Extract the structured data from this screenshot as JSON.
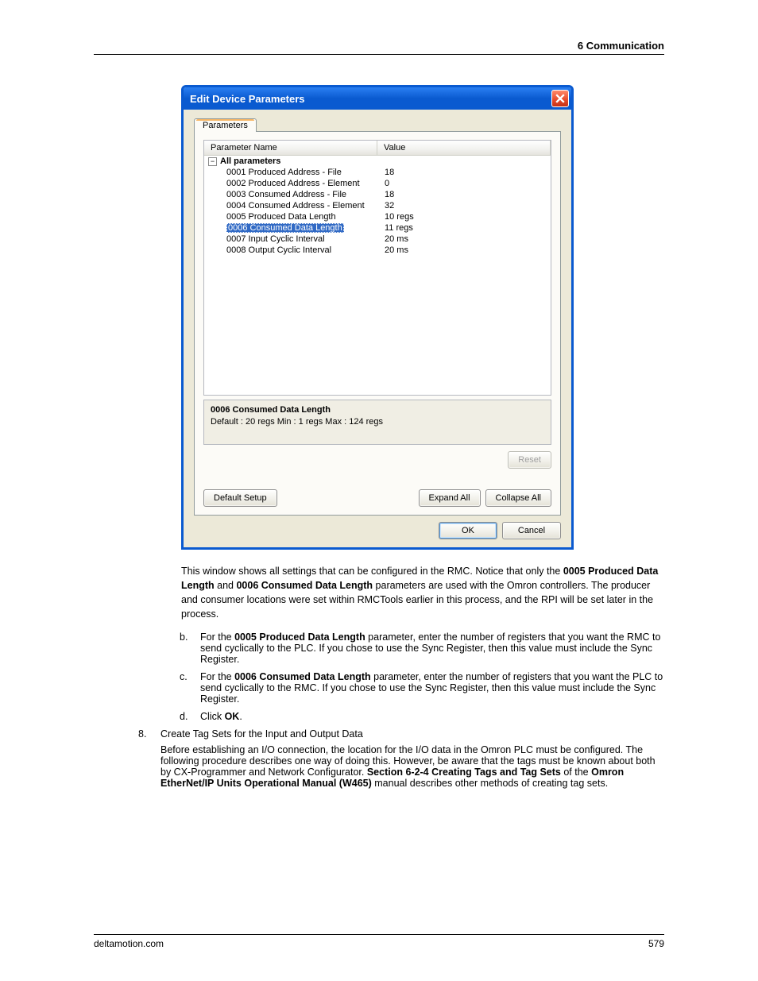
{
  "header": {
    "title": "6  Communication"
  },
  "footer": {
    "site": "deltamotion.com",
    "page": "579"
  },
  "dialog": {
    "title": "Edit Device Parameters",
    "tab_label": "Parameters",
    "columns": {
      "name": "Parameter Name",
      "value": "Value"
    },
    "group_label": "All parameters",
    "rows": [
      {
        "name": "0001 Produced Address - File",
        "value": "18"
      },
      {
        "name": "0002 Produced Address - Element",
        "value": "0"
      },
      {
        "name": "0003 Consumed Address - File",
        "value": "18"
      },
      {
        "name": "0004 Consumed Address - Element",
        "value": "32"
      },
      {
        "name": "0005 Produced Data Length",
        "value": "10 regs"
      },
      {
        "name": "0006 Consumed Data Length",
        "value": "11 regs",
        "selected": true
      },
      {
        "name": "0007 Input Cyclic Interval",
        "value": "20 ms"
      },
      {
        "name": "0008 Output Cyclic Interval",
        "value": "20 ms"
      }
    ],
    "detail": {
      "title": "0006 Consumed Data Length",
      "info": "Default : 20 regs  Min : 1 regs  Max : 124 regs"
    },
    "buttons": {
      "reset": "Reset",
      "default_setup": "Default Setup",
      "expand_all": "Expand All",
      "collapse_all": "Collapse All",
      "ok": "OK",
      "cancel": "Cancel"
    }
  },
  "text": {
    "dialog_caption_p1": "This window shows all settings that can be configured in the RMC. Notice that only the ",
    "dialog_caption_b1": "0005 Produced Data Length",
    "dialog_caption_p2": " and ",
    "dialog_caption_b2": "0006 Consumed Data Length",
    "dialog_caption_p3": " parameters are used with the Omron controllers. The producer and consumer locations were set within RMCTools earlier in this process, and the RPI will be set later in the process.",
    "b_marker": "b.",
    "b_p1": "For the ",
    "b_b1": "0005 Produced Data Length",
    "b_p2": " parameter, enter the number of registers that you want the RMC to send cyclically to the PLC. If you chose to use the Sync Register, then this value must include the Sync Register.",
    "c_marker": "c.",
    "c_p1": "For the ",
    "c_b1": "0006 Consumed Data Length",
    "c_p2": " parameter, enter the number of registers that you want the PLC to send cyclically to the RMC. If you chose to use the Sync Register, then this value must include the Sync Register.",
    "d_marker": "d.",
    "d_p1": "Click ",
    "d_b1": "OK",
    "d_p2": ".",
    "s8_marker": "8.",
    "s8_title": "Create Tag Sets for the Input and Output Data",
    "s8_p1": "Before establishing an I/O connection, the location for the I/O data in the Omron PLC must be configured. The following procedure describes one way of doing this. However, be aware that the tags must be known about both by CX-Programmer and Network Configurator. ",
    "s8_b1": "Section 6-2-4 Creating Tags and Tag Sets",
    "s8_p2": " of the ",
    "s8_b2": "Omron EtherNet/IP Units Operational Manual (W465)",
    "s8_p3": " manual describes other methods of creating tag sets."
  }
}
